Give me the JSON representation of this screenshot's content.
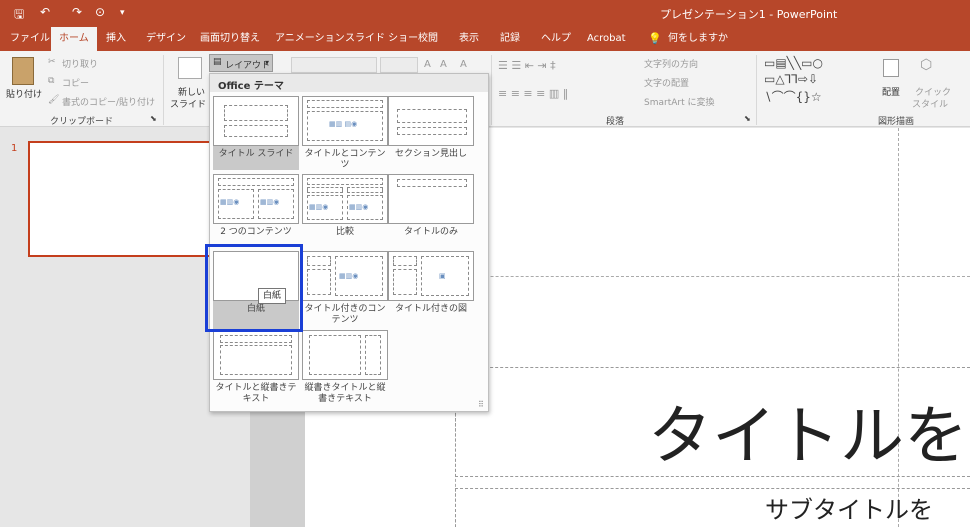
{
  "window": {
    "title": "プレゼンテーション1 - PowerPoint"
  },
  "qat": {
    "save": "🖫",
    "undo": "↶",
    "redo": "↷",
    "start": "⊙",
    "more": "▾"
  },
  "tabs": [
    "ファイル",
    "ホーム",
    "挿入",
    "デザイン",
    "画面切り替え",
    "アニメーション",
    "スライド ショー",
    "校閲",
    "表示",
    "記録",
    "ヘルプ",
    "Acrobat",
    "何をしますか"
  ],
  "clipboard": {
    "paste": "貼り付け",
    "cut": "切り取り",
    "copy": "コピー",
    "format": "書式のコピー/貼り付け",
    "group": "クリップボード"
  },
  "slides": {
    "new": "新しい",
    "new2": "スライド",
    "layout": "レイアウト"
  },
  "paragraph": {
    "text_dir": "文字列の方向",
    "align": "文字の配置",
    "smartart": "SmartArt に変換",
    "group": "段落"
  },
  "drawing": {
    "arrange": "配置",
    "quick": "クイック",
    "style": "スタイル",
    "group": "図形描画"
  },
  "gallery": {
    "header": "Office テーマ",
    "layouts": [
      {
        "label": "タイトル スライド"
      },
      {
        "label": "タイトルとコンテンツ"
      },
      {
        "label": "セクション見出し"
      },
      {
        "label": "2 つのコンテンツ"
      },
      {
        "label": "比較"
      },
      {
        "label": "タイトルのみ"
      },
      {
        "label": "白紙"
      },
      {
        "label": "タイトル付きのコンテンツ"
      },
      {
        "label": "タイトル付きの図"
      },
      {
        "label": "タイトルと縦書きテキスト"
      },
      {
        "label": "縦書きタイトルと縦書きテキスト"
      }
    ],
    "tooltip": "白紙"
  },
  "slide_pane": {
    "number": "1"
  },
  "canvas": {
    "title": "タイトルを",
    "subtitle": "サブタイトルを"
  },
  "colors": {
    "brand": "#b7472a",
    "selection": "#1a3fd6"
  }
}
